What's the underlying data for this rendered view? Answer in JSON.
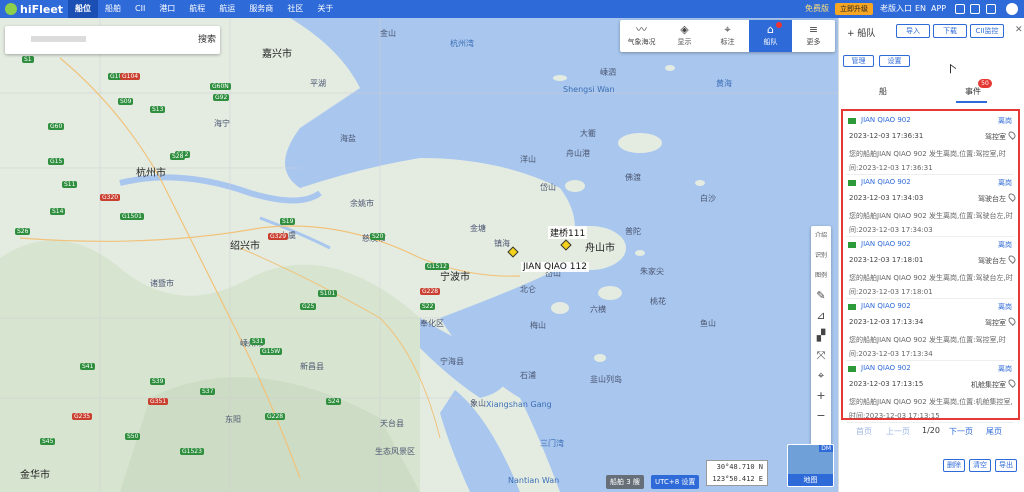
{
  "topbar": {
    "brand": "hiFleet",
    "nav": [
      "船位",
      "船舶",
      "CII",
      "港口",
      "航程",
      "航运",
      "服务商",
      "社区",
      "关于"
    ],
    "active": 0,
    "free": "免费版",
    "pay": "立即升级",
    "old": "老版入口",
    "lang": "EN",
    "app": "APP"
  },
  "search": {
    "button": "搜索"
  },
  "toolbar": [
    {
      "icon": "〰",
      "label": "气象海况"
    },
    {
      "icon": "◈",
      "label": "显示"
    },
    {
      "icon": "⌖",
      "label": "标注"
    },
    {
      "icon": "⌂",
      "label": "船队"
    },
    {
      "icon": "≡",
      "label": "更多"
    }
  ],
  "right_tools": [
    "介绍",
    "识别",
    "图例",
    "✎",
    "⊿",
    "▞",
    "⤧",
    "⌖",
    "+",
    "−"
  ],
  "map": {
    "cities": [
      "嘉兴市",
      "杭州市",
      "绍兴市",
      "宁波市",
      "舟山市",
      "金华市"
    ],
    "places": [
      "杭州湾",
      "金山",
      "嵊泗",
      "洋山",
      "岱山",
      "象山",
      "余姚市",
      "慈溪市",
      "奉化区",
      "镇海",
      "北仑",
      "嵊州市",
      "新昌县",
      "宁海县",
      "天台县",
      "上虞",
      "诸暨市",
      "海宁",
      "平湖",
      "东阳",
      "石浦",
      "Shengsi Wan",
      "Xiangshan Gang",
      "Nantian Wan",
      "生态风景区",
      "黄海",
      "佛渡",
      "大衢",
      "梅山",
      "三门湾",
      "韭山列岛",
      "海盐",
      "舟山港",
      "金塘",
      "六横",
      "普陀",
      "朱家尖",
      "桃花",
      "白沙",
      "鱼山",
      "岙山"
    ],
    "ships": [
      "建桥111",
      "JIAN QIAO 112"
    ],
    "road_signs_green": [
      "G104",
      "S09",
      "S1",
      "G60",
      "S13",
      "G15",
      "S12",
      "G1501",
      "S28",
      "S11",
      "G92",
      "S14",
      "S26",
      "G60N",
      "S19",
      "S20",
      "G1512",
      "S101",
      "S22",
      "G15W",
      "S24",
      "S31",
      "G1523",
      "S45",
      "S50",
      "G25",
      "S39",
      "S41",
      "G228",
      "S37"
    ],
    "road_signs_red": [
      "G320",
      "G104",
      "G329",
      "G228",
      "G351",
      "G235"
    ],
    "ship_count": "船舶 3 艘",
    "utc": "UTC+8 设置",
    "coord_lat": "30°48.710 N",
    "coord_lon": "123°50.412 E",
    "mini_tag": "DM",
    "mini_label": "地图"
  },
  "panel": {
    "title": "船队",
    "close": "✕",
    "buttons": [
      "导入",
      "下载",
      "CII监控"
    ],
    "sub_buttons": [
      "管理",
      "设置"
    ],
    "tabs": [
      "船",
      "事件"
    ],
    "badge": "50",
    "events": [
      {
        "name": "JIAN QIAO 902",
        "type": "离岗",
        "time": "2023-12-03 17:36:31",
        "location": "驾控室",
        "message": "您的船舶JIAN QIAO 902 发生离岗,位置:驾控室,时间:2023-12-03 17:36:31"
      },
      {
        "name": "JIAN QIAO 902",
        "type": "离岗",
        "time": "2023-12-03 17:34:03",
        "location": "驾驶台左",
        "message": "您的船舶JIAN QIAO 902 发生离岗,位置:驾驶台左,时间:2023-12-03 17:34:03"
      },
      {
        "name": "JIAN QIAO 902",
        "type": "离岗",
        "time": "2023-12-03 17:18:01",
        "location": "驾驶台左",
        "message": "您的船舶JIAN QIAO 902 发生离岗,位置:驾驶台左,时间:2023-12-03 17:18:01"
      },
      {
        "name": "JIAN QIAO 902",
        "type": "离岗",
        "time": "2023-12-03 17:13:34",
        "location": "驾控室",
        "message": "您的船舶JIAN QIAO 902 发生离岗,位置:驾控室,时间:2023-12-03 17:13:34"
      },
      {
        "name": "JIAN QIAO 902",
        "type": "离岗",
        "time": "2023-12-03 17:13:15",
        "location": "机舱集控室",
        "message": "您的船舶JIAN QIAO 902 发生离岗,位置:机舱集控室,时间:2023-12-03 17:13:15"
      }
    ],
    "pager": {
      "first": "首页",
      "prev": "上一页",
      "page": "1/20",
      "next": "下一页",
      "last": "尾页"
    },
    "bottom_buttons": [
      "删除",
      "清空",
      "导出"
    ]
  }
}
